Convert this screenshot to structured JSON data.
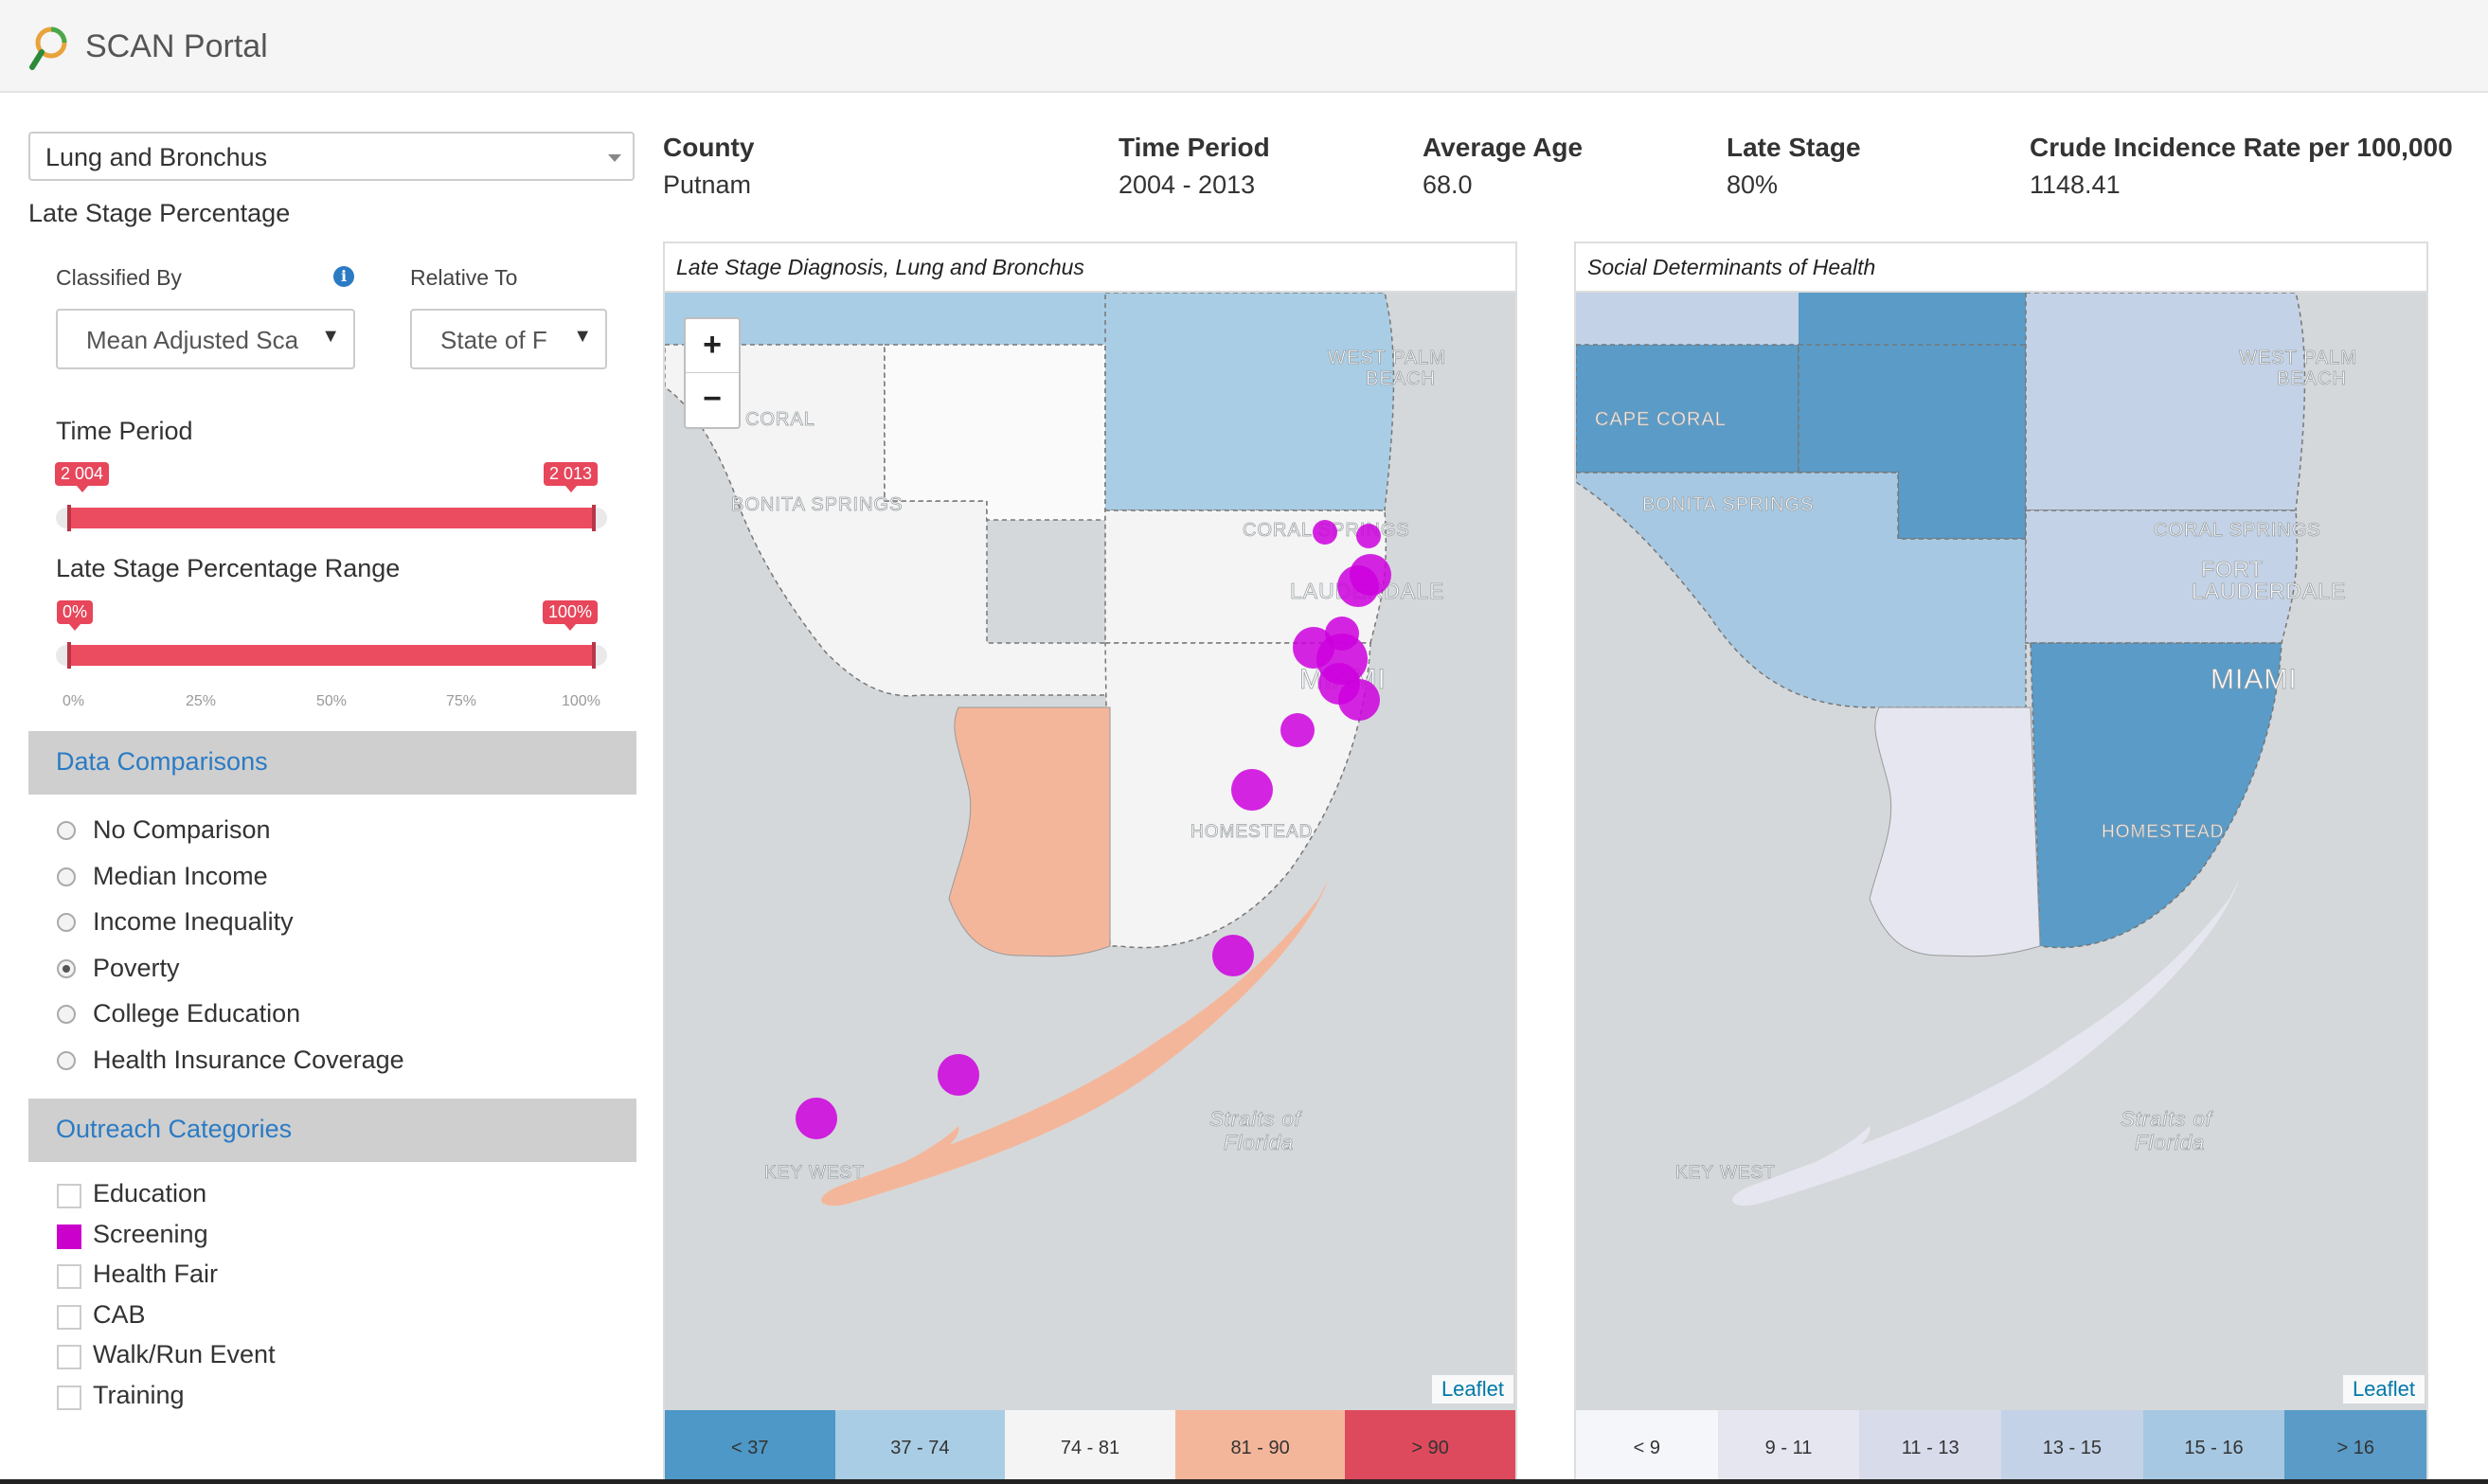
{
  "app": {
    "title": "SCAN Portal"
  },
  "sidebar": {
    "cancer_select": "Lung and Bronchus",
    "metric_label": "Late Stage Percentage",
    "classified_by_label": "Classified By",
    "classified_by_value": "Mean Adjusted Sca",
    "relative_to_label": "Relative To",
    "relative_to_value": "State of F",
    "time_period": {
      "label": "Time Period",
      "from": "2 004",
      "to": "2 013",
      "fill_start": 0.0,
      "fill_end": 1.0
    },
    "range": {
      "label": "Late Stage Percentage Range",
      "from": "0%",
      "to": "100%",
      "grid": [
        "0%",
        "25%",
        "50%",
        "75%",
        "100%"
      ]
    },
    "data_comparisons": {
      "title": "Data Comparisons",
      "options": [
        {
          "label": "No Comparison",
          "checked": false
        },
        {
          "label": "Median Income",
          "checked": false
        },
        {
          "label": "Income Inequality",
          "checked": false
        },
        {
          "label": "Poverty",
          "checked": true
        },
        {
          "label": "College Education",
          "checked": false
        },
        {
          "label": "Health Insurance Coverage",
          "checked": false
        }
      ]
    },
    "outreach": {
      "title": "Outreach Categories",
      "options": [
        {
          "label": "Education",
          "checked": false
        },
        {
          "label": "Screening",
          "checked": true
        },
        {
          "label": "Health Fair",
          "checked": false
        },
        {
          "label": "CAB",
          "checked": false
        },
        {
          "label": "Walk/Run Event",
          "checked": false
        },
        {
          "label": "Training",
          "checked": false
        }
      ]
    }
  },
  "stats": {
    "county": {
      "label": "County",
      "value": "Putnam"
    },
    "time_period": {
      "label": "Time Period",
      "value": "2004 - 2013"
    },
    "average_age": {
      "label": "Average Age",
      "value": "68.0"
    },
    "late_stage": {
      "label": "Late Stage",
      "value": "80%"
    },
    "crude_rate": {
      "label": "Crude Incidence Rate per 100,000",
      "value": "1148.41"
    }
  },
  "map_left": {
    "title": "Late Stage Diagnosis, Lung and Bronchus",
    "zoom_in": "+",
    "zoom_out": "−",
    "attribution": "Leaflet",
    "legend": [
      {
        "label": "< 37",
        "color": "#4d98c6"
      },
      {
        "label": "37 - 74",
        "color": "#a9cde4"
      },
      {
        "label": "74 - 81",
        "color": "#f4f4f4"
      },
      {
        "label": "81 - 90",
        "color": "#f4b69a"
      },
      {
        "label": "> 90",
        "color": "#de4a5d"
      }
    ]
  },
  "map_right": {
    "title": "Social Determinants of Health",
    "attribution": "Leaflet",
    "legend": [
      {
        "label": "< 9",
        "color": "#f4f6fa"
      },
      {
        "label": "9 - 11",
        "color": "#e6e6f1"
      },
      {
        "label": "11 - 13",
        "color": "#d8dbea"
      },
      {
        "label": "13 - 15",
        "color": "#c3d2e6"
      },
      {
        "label": "15 - 16",
        "color": "#a6c8e2"
      },
      {
        "label": "> 16",
        "color": "#5a9bc7"
      }
    ]
  },
  "map_labels": {
    "west_palm": "WEST PALM",
    "beach": "BEACH",
    "cape_coral": "CAPE CORAL",
    "bonita": "BONITA SPRINGS",
    "coral_springs": "CORAL SPRINGS",
    "fort": "FORT",
    "lauderdale": "LAUDERDALE",
    "miami": "MIAMI",
    "homestead": "HOMESTEAD",
    "straits": "Straits of",
    "florida": "Florida",
    "key_west": "KEY WEST"
  }
}
